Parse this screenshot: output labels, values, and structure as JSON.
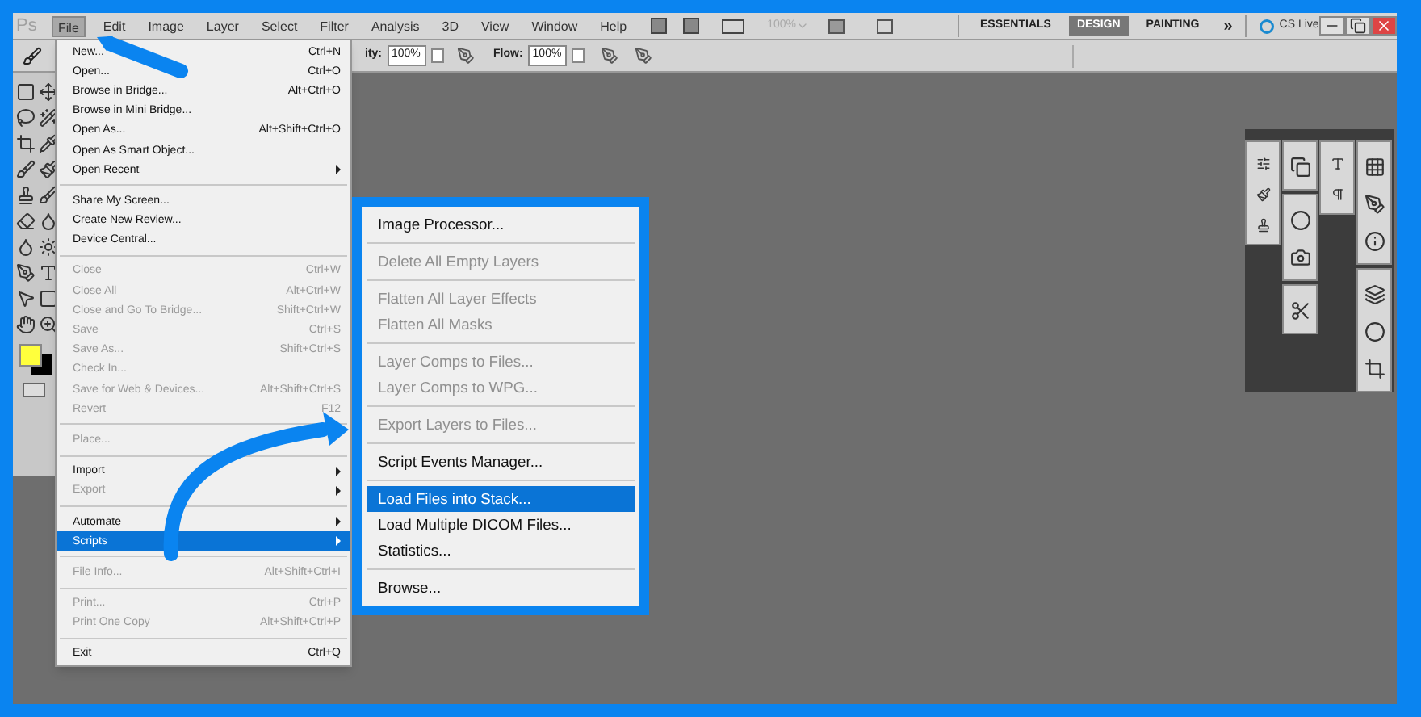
{
  "menu_bar": {
    "logo": "Ps",
    "menus": [
      {
        "label": "File",
        "selected": true
      },
      {
        "label": "Edit",
        "selected": false
      },
      {
        "label": "Image",
        "selected": false
      },
      {
        "label": "Layer",
        "selected": false
      },
      {
        "label": "Select",
        "selected": false
      },
      {
        "label": "Filter",
        "selected": false
      },
      {
        "label": "Analysis",
        "selected": false
      },
      {
        "label": "3D",
        "selected": false
      },
      {
        "label": "View",
        "selected": false
      },
      {
        "label": "Window",
        "selected": false
      },
      {
        "label": "Help",
        "selected": false
      }
    ],
    "zoom": "100%",
    "workspaces": [
      {
        "label": "ESSENTIALS",
        "selected": false
      },
      {
        "label": "DESIGN",
        "selected": true
      },
      {
        "label": "PAINTING",
        "selected": false
      }
    ],
    "more": "»",
    "cs_live": "CS Live"
  },
  "options_bar": {
    "opacity_label": "ity:",
    "opacity": "100%",
    "flow_label": "Flow:",
    "flow": "100%"
  },
  "file_menu": [
    {
      "kind": "item",
      "label": "New...",
      "shortcut": "Ctrl+N",
      "disabled": false,
      "submenu": false,
      "selected": false
    },
    {
      "kind": "item",
      "label": "Open...",
      "shortcut": "Ctrl+O",
      "disabled": false,
      "submenu": false,
      "selected": false
    },
    {
      "kind": "item",
      "label": "Browse in Bridge...",
      "shortcut": "Alt+Ctrl+O",
      "disabled": false,
      "submenu": false,
      "selected": false
    },
    {
      "kind": "item",
      "label": "Browse in Mini Bridge...",
      "disabled": false,
      "submenu": false,
      "selected": false
    },
    {
      "kind": "item",
      "label": "Open As...",
      "shortcut": "Alt+Shift+Ctrl+O",
      "disabled": false,
      "submenu": false,
      "selected": false
    },
    {
      "kind": "item",
      "label": "Open As Smart Object...",
      "disabled": false,
      "submenu": false,
      "selected": false
    },
    {
      "kind": "item",
      "label": "Open Recent",
      "disabled": false,
      "submenu": true,
      "selected": false
    },
    {
      "kind": "separator"
    },
    {
      "kind": "item",
      "label": "Share My Screen...",
      "disabled": false,
      "submenu": false,
      "selected": false
    },
    {
      "kind": "item",
      "label": "Create New Review...",
      "disabled": false,
      "submenu": false,
      "selected": false
    },
    {
      "kind": "item",
      "label": "Device Central...",
      "disabled": false,
      "submenu": false,
      "selected": false
    },
    {
      "kind": "separator"
    },
    {
      "kind": "item",
      "label": "Close",
      "shortcut": "Ctrl+W",
      "disabled": true,
      "submenu": false,
      "selected": false
    },
    {
      "kind": "item",
      "label": "Close All",
      "shortcut": "Alt+Ctrl+W",
      "disabled": true,
      "submenu": false,
      "selected": false
    },
    {
      "kind": "item",
      "label": "Close and Go To Bridge...",
      "shortcut": "Shift+Ctrl+W",
      "disabled": true,
      "submenu": false,
      "selected": false
    },
    {
      "kind": "item",
      "label": "Save",
      "shortcut": "Ctrl+S",
      "disabled": true,
      "submenu": false,
      "selected": false
    },
    {
      "kind": "item",
      "label": "Save As...",
      "shortcut": "Shift+Ctrl+S",
      "disabled": true,
      "submenu": false,
      "selected": false
    },
    {
      "kind": "item",
      "label": "Check In...",
      "disabled": true,
      "submenu": false,
      "selected": false
    },
    {
      "kind": "item",
      "label": "Save for Web & Devices...",
      "shortcut": "Alt+Shift+Ctrl+S",
      "disabled": true,
      "submenu": false,
      "selected": false
    },
    {
      "kind": "item",
      "label": "Revert",
      "shortcut": "F12",
      "disabled": true,
      "submenu": false,
      "selected": false
    },
    {
      "kind": "separator"
    },
    {
      "kind": "item",
      "label": "Place...",
      "disabled": true,
      "submenu": false,
      "selected": false
    },
    {
      "kind": "separator"
    },
    {
      "kind": "item",
      "label": "Import",
      "disabled": false,
      "submenu": true,
      "selected": false
    },
    {
      "kind": "item",
      "label": "Export",
      "disabled": true,
      "submenu": true,
      "selected": false
    },
    {
      "kind": "separator"
    },
    {
      "kind": "item",
      "label": "Automate",
      "disabled": false,
      "submenu": true,
      "selected": false
    },
    {
      "kind": "item",
      "label": "Scripts",
      "disabled": false,
      "submenu": true,
      "selected": true
    },
    {
      "kind": "separator"
    },
    {
      "kind": "item",
      "label": "File Info...",
      "shortcut": "Alt+Shift+Ctrl+I",
      "disabled": true,
      "submenu": false,
      "selected": false
    },
    {
      "kind": "separator"
    },
    {
      "kind": "item",
      "label": "Print...",
      "shortcut": "Ctrl+P",
      "disabled": true,
      "submenu": false,
      "selected": false
    },
    {
      "kind": "item",
      "label": "Print One Copy",
      "shortcut": "Alt+Shift+Ctrl+P",
      "disabled": true,
      "submenu": false,
      "selected": false
    },
    {
      "kind": "separator"
    },
    {
      "kind": "item",
      "label": "Exit",
      "shortcut": "Ctrl+Q",
      "disabled": false,
      "submenu": false,
      "selected": false
    }
  ],
  "scripts_menu": [
    {
      "kind": "item",
      "label": "Image Processor...",
      "disabled": false,
      "selected": false
    },
    {
      "kind": "separator"
    },
    {
      "kind": "item",
      "label": "Delete All Empty Layers",
      "disabled": true,
      "selected": false
    },
    {
      "kind": "separator"
    },
    {
      "kind": "item",
      "label": "Flatten All Layer Effects",
      "disabled": true,
      "selected": false
    },
    {
      "kind": "item",
      "label": "Flatten All Masks",
      "disabled": true,
      "selected": false
    },
    {
      "kind": "separator"
    },
    {
      "kind": "item",
      "label": "Layer Comps to Files...",
      "disabled": true,
      "selected": false
    },
    {
      "kind": "item",
      "label": "Layer Comps to WPG...",
      "disabled": true,
      "selected": false
    },
    {
      "kind": "separator"
    },
    {
      "kind": "item",
      "label": "Export Layers to Files...",
      "disabled": true,
      "selected": false
    },
    {
      "kind": "separator"
    },
    {
      "kind": "item",
      "label": "Script Events Manager...",
      "disabled": false,
      "selected": false
    },
    {
      "kind": "separator"
    },
    {
      "kind": "item",
      "label": "Load Files into Stack...",
      "disabled": false,
      "selected": true
    },
    {
      "kind": "item",
      "label": "Load Multiple DICOM Files...",
      "disabled": false,
      "selected": false
    },
    {
      "kind": "item",
      "label": "Statistics...",
      "disabled": false,
      "selected": false
    },
    {
      "kind": "separator"
    },
    {
      "kind": "item",
      "label": "Browse...",
      "disabled": false,
      "selected": false
    }
  ]
}
